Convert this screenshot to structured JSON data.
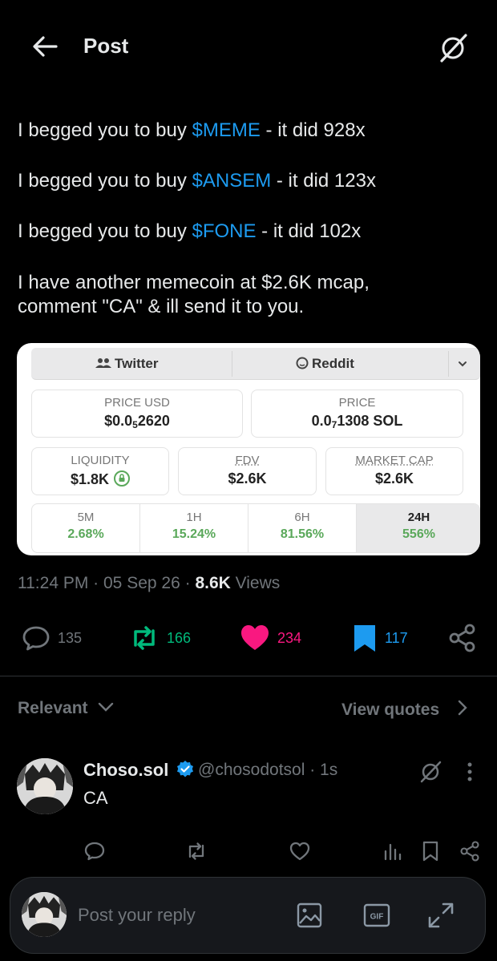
{
  "header": {
    "title": "Post"
  },
  "post": {
    "paragraphs": [
      {
        "prefix": "I begged you to buy ",
        "ticker": "$MEME",
        "suffix": " - it did 928x"
      },
      {
        "prefix": "I begged you to buy ",
        "ticker": "$ANSEM",
        "suffix": " - it did 123x"
      },
      {
        "prefix": "I begged you to buy ",
        "ticker": "$FONE",
        "suffix": " - it did 102x"
      }
    ],
    "closing_line1": "I have another memecoin at $2.6K mcap,",
    "closing_line2": "comment \"CA\" & ill send it to you.",
    "link_color": "#1d9bf0"
  },
  "card": {
    "tabs": [
      "Twitter",
      "Reddit"
    ],
    "price_usd": {
      "label": "PRICE USD",
      "prefix": "$0.0",
      "sub": "5",
      "suffix": "2620"
    },
    "price": {
      "label": "PRICE",
      "prefix": "0.0",
      "sub": "7",
      "suffix": "1308 SOL"
    },
    "liquidity": {
      "label": "LIQUIDITY",
      "value": "$1.8K"
    },
    "fdv": {
      "label": "FDV",
      "value": "$2.6K"
    },
    "market_cap": {
      "label": "MARKET CAP",
      "value": "$2.6K"
    },
    "changes": [
      {
        "label": "5M",
        "value": "2.68%"
      },
      {
        "label": "1H",
        "value": "15.24%"
      },
      {
        "label": "6H",
        "value": "81.56%"
      },
      {
        "label": "24H",
        "value": "556%"
      }
    ],
    "positive_color": "#5aa85a"
  },
  "meta": {
    "time": "11:24 PM",
    "date": "05 Sep 26",
    "views_count": "8.6K",
    "views_label": "Views"
  },
  "actions": {
    "replies": "135",
    "reposts": "166",
    "likes": "234",
    "bookmarks": "117",
    "repost_color": "#00ba7c",
    "like_color": "#f91880",
    "bookmark_color": "#1d9bf0"
  },
  "sort": {
    "relevant": "Relevant",
    "view_quotes": "View quotes"
  },
  "reply": {
    "name": "Choso.sol",
    "handle": "@chosodotsol · 1s",
    "text": "CA"
  },
  "composer": {
    "placeholder": "Post your reply"
  }
}
